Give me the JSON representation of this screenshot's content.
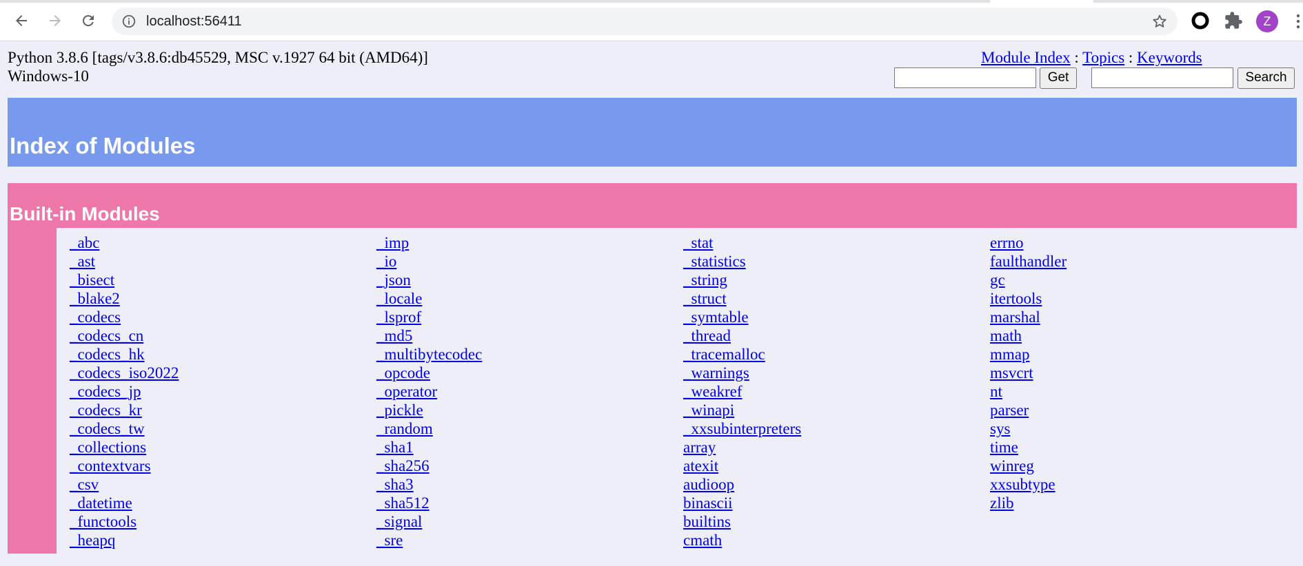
{
  "browser": {
    "url": "localhost:56411",
    "avatar_letter": "Z"
  },
  "page": {
    "sysinfo_line1": "Python 3.8.6 [tags/v3.8.6:db45529, MSC v.1927 64 bit (AMD64)]",
    "sysinfo_line2": "Windows-10",
    "links": {
      "module_index": "Module Index",
      "topics": "Topics",
      "keywords": "Keywords",
      "separator": " : "
    },
    "get_button": "Get",
    "search_button": "Search",
    "get_value": "",
    "search_value": "",
    "title": "Index of Modules",
    "section_title": "Built-in Modules",
    "colors": {
      "heading_blue": "#7799ee",
      "section_pink": "#ee77aa",
      "link": "#0000ee",
      "background": "#eeeef8"
    },
    "module_columns": [
      [
        "_abc",
        "_ast",
        "_bisect",
        "_blake2",
        "_codecs",
        "_codecs_cn",
        "_codecs_hk",
        "_codecs_iso2022",
        "_codecs_jp",
        "_codecs_kr",
        "_codecs_tw",
        "_collections",
        "_contextvars",
        "_csv",
        "_datetime",
        "_functools",
        "_heapq"
      ],
      [
        "_imp",
        "_io",
        "_json",
        "_locale",
        "_lsprof",
        "_md5",
        "_multibytecodec",
        "_opcode",
        "_operator",
        "_pickle",
        "_random",
        "_sha1",
        "_sha256",
        "_sha3",
        "_sha512",
        "_signal",
        "_sre"
      ],
      [
        "_stat",
        "_statistics",
        "_string",
        "_struct",
        "_symtable",
        "_thread",
        "_tracemalloc",
        "_warnings",
        "_weakref",
        "_winapi",
        "_xxsubinterpreters",
        "array",
        "atexit",
        "audioop",
        "binascii",
        "builtins",
        "cmath"
      ],
      [
        "errno",
        "faulthandler",
        "gc",
        "itertools",
        "marshal",
        "math",
        "mmap",
        "msvcrt",
        "nt",
        "parser",
        "sys",
        "time",
        "winreg",
        "xxsubtype",
        "zlib"
      ]
    ]
  }
}
